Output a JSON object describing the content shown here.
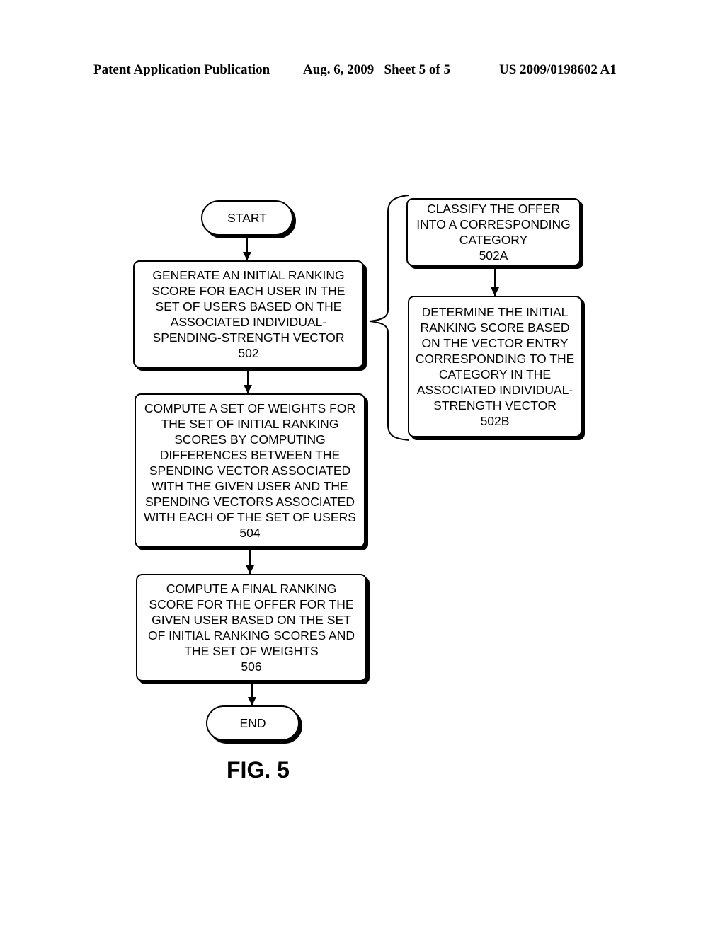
{
  "header": {
    "publication": "Patent Application Publication",
    "date_sheet": "Aug. 6, 2009   Sheet 5 of 5",
    "number": "US 2009/0198602 A1"
  },
  "flowchart": {
    "start": "START",
    "end": "END",
    "steps": [
      {
        "id": "502",
        "lines": [
          "GENERATE AN INITIAL RANKING",
          "SCORE FOR EACH USER IN THE",
          "SET OF USERS BASED ON THE",
          "ASSOCIATED INDIVIDUAL-",
          "SPENDING-STRENGTH VECTOR"
        ],
        "ref": "502"
      },
      {
        "id": "504",
        "lines": [
          "COMPUTE A SET OF WEIGHTS FOR",
          "THE SET OF INITIAL RANKING",
          "SCORES BY COMPUTING",
          "DIFFERENCES BETWEEN THE",
          "SPENDING VECTOR ASSOCIATED",
          "WITH THE GIVEN USER AND THE",
          "SPENDING VECTORS ASSOCIATED",
          "WITH EACH OF THE SET OF USERS"
        ],
        "ref": "504"
      },
      {
        "id": "506",
        "lines": [
          "COMPUTE A FINAL RANKING",
          "SCORE FOR THE OFFER FOR THE",
          "GIVEN USER BASED ON THE SET",
          "OF INITIAL RANKING SCORES AND",
          "THE SET OF WEIGHTS"
        ],
        "ref": "506"
      }
    ],
    "substeps": [
      {
        "id": "502A",
        "lines": [
          "CLASSIFY THE OFFER",
          "INTO A CORRESPONDING",
          "CATEGORY"
        ],
        "ref": "502A"
      },
      {
        "id": "502B",
        "lines": [
          "DETERMINE THE INITIAL",
          "RANKING SCORE BASED",
          "ON THE VECTOR ENTRY",
          "CORRESPONDING TO THE",
          "CATEGORY IN THE",
          "ASSOCIATED INDIVIDUAL-",
          "STRENGTH VECTOR"
        ],
        "ref": "502B"
      }
    ],
    "figure_label": "FIG. 5"
  }
}
